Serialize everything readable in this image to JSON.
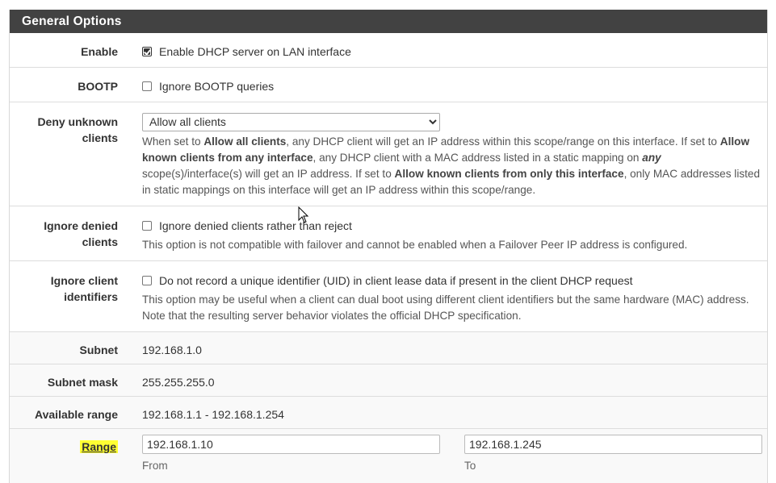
{
  "panel": {
    "title": "General Options"
  },
  "enable": {
    "label": "Enable",
    "checkbox_label": "Enable DHCP server on LAN interface",
    "checked": true
  },
  "bootp": {
    "label": "BOOTP",
    "checkbox_label": "Ignore BOOTP queries",
    "checked": false
  },
  "deny_unknown": {
    "label_line1": "Deny unknown",
    "label_line2": "clients",
    "selected": "Allow all clients",
    "help": {
      "p1": "When set to ",
      "b1": "Allow all clients",
      "p2": ", any DHCP client will get an IP address within this scope/range on this interface. If set to ",
      "b2": "Allow known clients from any interface",
      "p3": ", any DHCP client with a MAC address listed in a static mapping on ",
      "i1": "any",
      "p4": " scope(s)/interface(s) will get an IP address. If set to ",
      "b3": "Allow known clients from only this interface",
      "p5": ", only MAC addresses listed in static mappings on this interface will get an IP address within this scope/range."
    }
  },
  "ignore_denied": {
    "label_line1": "Ignore denied",
    "label_line2": "clients",
    "checkbox_label": "Ignore denied clients rather than reject",
    "checked": false,
    "help": "This option is not compatible with failover and cannot be enabled when a Failover Peer IP address is configured."
  },
  "ignore_client_id": {
    "label_line1": "Ignore client",
    "label_line2": "identifiers",
    "checkbox_label": "Do not record a unique identifier (UID) in client lease data if present in the client DHCP request",
    "checked": false,
    "help": "This option may be useful when a client can dual boot using different client identifiers but the same hardware (MAC) address. Note that the resulting server behavior violates the official DHCP specification."
  },
  "subnet": {
    "label": "Subnet",
    "value": "192.168.1.0"
  },
  "subnet_mask": {
    "label": "Subnet mask",
    "value": "255.255.255.0"
  },
  "available_range": {
    "label": "Available range",
    "value": "192.168.1.1 - 192.168.1.254"
  },
  "range": {
    "label": "Range",
    "from_value": "192.168.1.10",
    "from_label": "From",
    "to_value": "192.168.1.245",
    "to_label": "To"
  },
  "colors": {
    "header_bg": "#424242",
    "highlight": "#ffff33"
  }
}
